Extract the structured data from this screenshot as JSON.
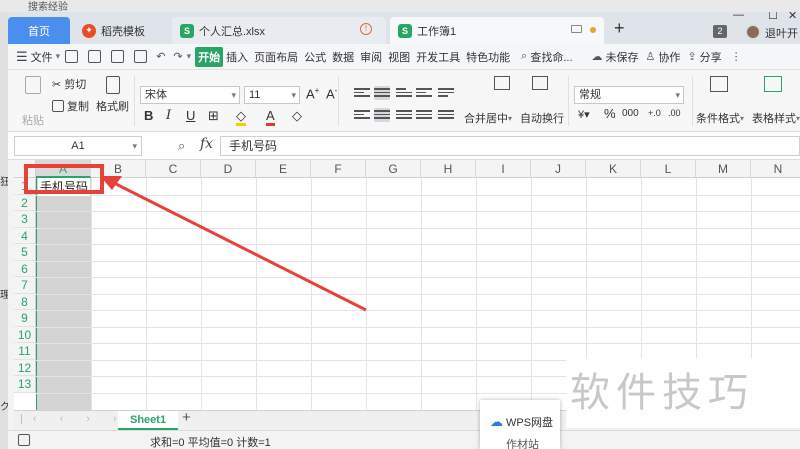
{
  "background": {
    "top_text": "搜索经验",
    "side": [
      "狂",
      "理",
      "ク"
    ]
  },
  "tabs": {
    "home": "首页",
    "daoke": "稻壳模板",
    "xlsx": "个人汇总.xlsx",
    "book": "工作簿1",
    "new_tab": "+",
    "count": "2",
    "exit": "退叶开"
  },
  "menu": {
    "items": [
      "开始",
      "插入",
      "页面布局",
      "公式",
      "数据",
      "审阅",
      "视图",
      "开发工具",
      "特色功能"
    ],
    "file": "文件",
    "search": "查找命...",
    "unsaved": "未保存",
    "collab": "协作",
    "share": "分享"
  },
  "ribbon": {
    "paste": "粘贴",
    "cut": "剪切",
    "copy": "复制",
    "format_painter": "格式刷",
    "font": "宋体",
    "size": "11",
    "bold": "B",
    "italic": "I",
    "underline": "U",
    "merge": "合并居中",
    "wrap": "自动换行",
    "number_format": "常规",
    "percent": "%",
    "cond_format": "条件格式",
    "table_style": "表格样式"
  },
  "formula": {
    "cell_ref": "A1",
    "fx": "fx",
    "content": "手机号码"
  },
  "grid": {
    "columns": [
      "A",
      "B",
      "C",
      "D",
      "E",
      "F",
      "G",
      "H",
      "I",
      "J",
      "K",
      "L",
      "M",
      "N"
    ],
    "rows": [
      "1",
      "2",
      "3",
      "4",
      "5",
      "6",
      "7",
      "8",
      "9",
      "10",
      "11",
      "12",
      "13"
    ],
    "A1": "手机号码"
  },
  "sheet": {
    "name": "Sheet1",
    "add": "+"
  },
  "status": {
    "text": "求和=0  平均值=0  计数=1"
  },
  "wps": {
    "label": "WPS网盘",
    "sub": "作材站"
  },
  "watermark": "软件技巧",
  "colors": {
    "accent": "#2aa566",
    "highlight": "#e8413a",
    "home_tab": "#4a8ef0"
  }
}
